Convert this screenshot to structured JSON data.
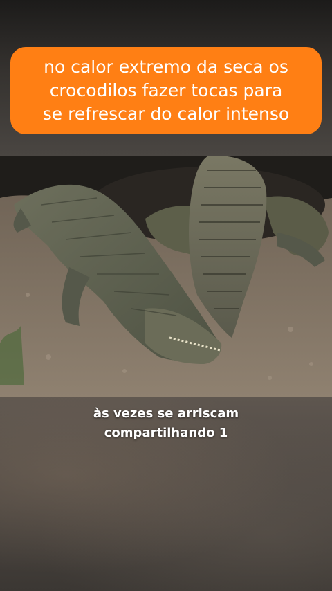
{
  "overlay": {
    "caption": "no calor extremo da seca os\ncrocodilos fazer tocas para\nse refrescar  do calor intenso",
    "caption_bg_color": "#ff7f14"
  },
  "video": {
    "scene": "crocodiles-at-burrow",
    "subtitle_line1": "às vezes se arriscam",
    "subtitle_line2": "compartilhando 1"
  }
}
